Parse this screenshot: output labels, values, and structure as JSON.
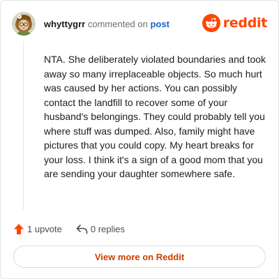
{
  "comment": {
    "author": "whyttygrr",
    "action_text": "commented on",
    "post_link_text": "post",
    "body": "NTA. She deliberately violated boundaries and took away so many irreplaceable objects. So much hurt was caused by her actions. You can possibly contact the landfill to recover some of your husband's belongings. They could probably tell you where stuff was dumped. Also, family might have pictures that you could copy. My heart breaks for your loss. I think it's a sign of a good mom that you are sending your daughter somewhere safe.",
    "upvotes": "1 upvote",
    "replies": "0 replies"
  },
  "brand": {
    "wordmark": "reddit",
    "icon": "reddit-snoo-icon",
    "color": "#ff4500"
  },
  "footer": {
    "view_more_label": "View more on Reddit"
  },
  "icons": {
    "avatar": "avatar",
    "upvote": "upvote-arrow-icon",
    "reply": "reply-arrow-icon"
  },
  "colors": {
    "upvote": "#ff4500",
    "link": "#1b63c6",
    "view_more_text": "#d13c00",
    "border": "#e2e4e6"
  }
}
